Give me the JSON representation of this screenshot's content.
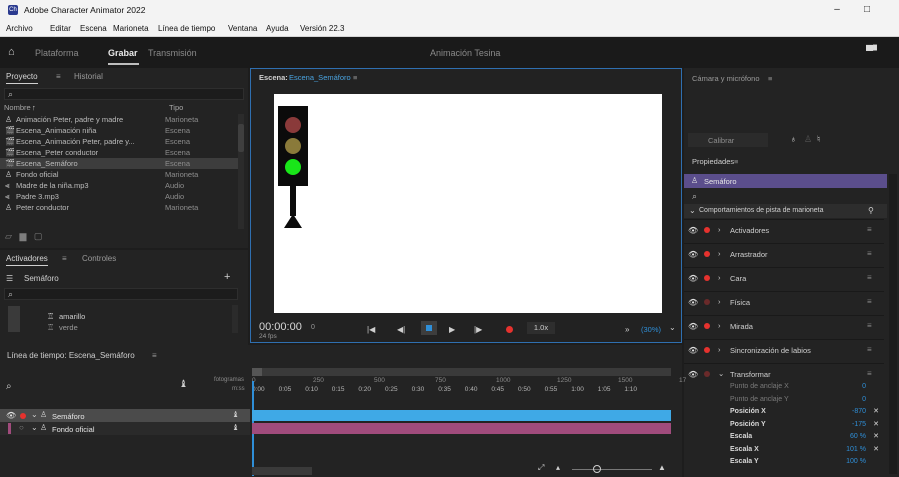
{
  "titlebar": {
    "app_icon": "Ch",
    "title": "Adobe Character Animator 2022",
    "minimize": "–",
    "maximize": "□"
  },
  "menu": [
    "Archivo",
    "Editar",
    "Escena",
    "Marioneta",
    "Línea de tiempo",
    "Ventana",
    "Ayuda",
    "Versión 22.3"
  ],
  "workspace": {
    "tabs": [
      "Plataforma",
      "Grabar",
      "Transmisión"
    ],
    "active": "Grabar",
    "center_title": "Animación Tesina",
    "home_icon": "home-icon",
    "chat_icon": "chat-icon"
  },
  "project": {
    "tabs": [
      "Proyecto",
      "Historial"
    ],
    "menu_glyph": "≡",
    "search_glyph": "⌕",
    "col_name": "Nombre",
    "col_type": "Tipo",
    "sort_glyph": "↑",
    "items": [
      {
        "icon": "puppet-icon",
        "glyph": "♙",
        "name": "Animación Peter, padre y madre",
        "type": "Marioneta"
      },
      {
        "icon": "scene-icon",
        "glyph": "🎬",
        "name": "Escena_Animación niña",
        "type": "Escena"
      },
      {
        "icon": "scene-icon",
        "glyph": "🎬",
        "name": "Escena_Animación Peter, padre y...",
        "type": "Escena"
      },
      {
        "icon": "scene-icon",
        "glyph": "🎬",
        "name": "Escena_Peter conductor",
        "type": "Escena"
      },
      {
        "icon": "scene-icon",
        "glyph": "🎬",
        "name": "Escena_Semáforo",
        "type": "Escena",
        "selected": true
      },
      {
        "icon": "puppet-icon",
        "glyph": "♙",
        "name": "Fondo oficial",
        "type": "Marioneta"
      },
      {
        "icon": "audio-icon",
        "glyph": "⫷",
        "name": "Madre de la niña.mp3",
        "type": "Audio"
      },
      {
        "icon": "audio-icon",
        "glyph": "⫷",
        "name": "Padre 3.mp3",
        "type": "Audio"
      },
      {
        "icon": "puppet-icon",
        "glyph": "♙",
        "name": "Peter conductor",
        "type": "Marioneta"
      }
    ]
  },
  "triggers": {
    "tabs": [
      "Activadores",
      "Controles"
    ],
    "menu_glyph": "≡",
    "puppet": "Semáforo",
    "add": "+",
    "items": [
      "amarillo",
      "verde"
    ]
  },
  "scene": {
    "label": "Escena:",
    "name": "Escena_Semáforo",
    "menu_glyph": "≡",
    "timecode": "00:00:00",
    "frame": "0",
    "fps": "24 fps",
    "speed": "1.0x",
    "zoom": "(30%)",
    "more": "»",
    "dropdown": "⌄",
    "transport_glyphs": {
      "start": "|◀",
      "prev": "◀|",
      "stop": "■",
      "play": "▶",
      "next": "|▶"
    }
  },
  "camera": {
    "title": "Cámara y micrófono",
    "menu_glyph": "≡",
    "calibrate": "Calibrar"
  },
  "properties": {
    "title": "Propiedades",
    "menu_glyph": "≡",
    "puppet": "Semáforo",
    "section": "Comportamientos de pista de marioneta",
    "behaviors": [
      {
        "label": "Activadores",
        "dot": true
      },
      {
        "label": "Arrastrador",
        "dot": true
      },
      {
        "label": "Cara",
        "dot": true
      },
      {
        "label": "Física",
        "dot": false
      },
      {
        "label": "Mirada",
        "dot": true
      },
      {
        "label": "Sincronización de labios",
        "dot": true
      }
    ],
    "transform": {
      "label": "Transformar",
      "params": [
        {
          "label": "Punto de anclaje X",
          "value": "0",
          "dim": true
        },
        {
          "label": "Punto de anclaje Y",
          "value": "0",
          "dim": true
        },
        {
          "label": "Posición X",
          "value": "-870",
          "x": "✕"
        },
        {
          "label": "Posición Y",
          "value": "-175",
          "x": "✕"
        },
        {
          "label": "Escala",
          "value": "60 %",
          "x": "✕"
        },
        {
          "label": "Escala X",
          "value": "101 %",
          "x": "✕"
        },
        {
          "label": "Escala Y",
          "value": "100 %"
        }
      ]
    }
  },
  "timeline": {
    "title": "Línea de tiempo: Escena_Semáforo",
    "menu_glyph": "≡",
    "fotogramas_label": "fotogramas",
    "mss_label": "m:ss",
    "frame_ticks": [
      "0",
      "250",
      "500",
      "750",
      "1000",
      "1250",
      "1500",
      "17"
    ],
    "time_ticks": [
      "0:00",
      "0:05",
      "0:10",
      "0:15",
      "0:20",
      "0:25",
      "0:30",
      "0:35",
      "0:40",
      "0:45",
      "0:50",
      "0:55",
      "1:00",
      "1:05",
      "1:10"
    ],
    "tracks": [
      {
        "name": "Semáforo",
        "color": "#3fa9e6"
      },
      {
        "name": "Fondo oficial",
        "color": "#a04b7c"
      }
    ]
  },
  "colors": {
    "accent": "#2f6fb0",
    "red_dot": "#e6322e",
    "light_red": "#8a3a3a",
    "light_yellow": "#8a7a3a",
    "light_green": "#19e619",
    "value_blue": "#2f8fd8",
    "puppet_bar": "#5b4e8c"
  }
}
